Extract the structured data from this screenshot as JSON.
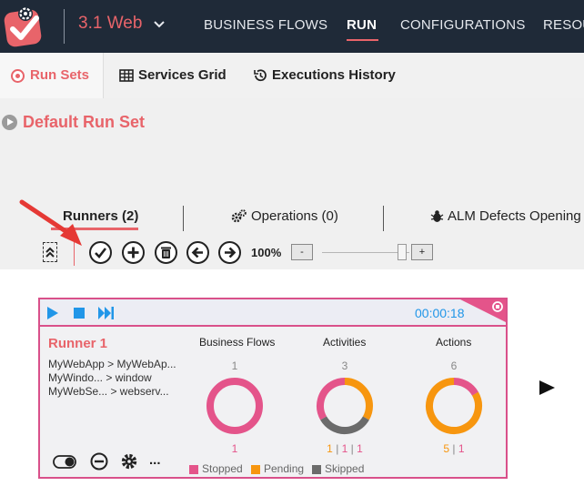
{
  "header": {
    "solution_name": "3.1 Web",
    "nav": [
      "BUSINESS FLOWS",
      "RUN",
      "CONFIGURATIONS",
      "RESOU"
    ]
  },
  "tabs": {
    "run_sets": "Run Sets",
    "services_grid": "Services Grid",
    "executions_history": "Executions History"
  },
  "runset": {
    "title": "Default Run Set",
    "subtabs": {
      "runners": "Runners (2)",
      "operations": "Operations (0)",
      "alm": "ALM Defects Opening"
    },
    "zoom": "100%",
    "zoom_minus": "-",
    "zoom_plus": "+",
    "zoom_level": 0.92
  },
  "runner": {
    "name": "Runner 1",
    "timer": "00:00:18",
    "flows": [
      "MyWebApp > MyWebAp...",
      "MyWindo... > window",
      "MyWebSe... > webserv..."
    ],
    "stats": {
      "business_flows": {
        "title": "Business Flows",
        "total": "1",
        "bottom": "1",
        "segments": [
          {
            "status": "Stopped",
            "value": 1
          }
        ]
      },
      "activities": {
        "title": "Activities",
        "total": "3",
        "bottom_parts": [
          "1",
          "1",
          "1"
        ],
        "segments": [
          {
            "status": "Stopped",
            "value": 1
          },
          {
            "status": "Pending",
            "value": 1
          },
          {
            "status": "Skipped",
            "value": 1
          }
        ]
      },
      "actions": {
        "title": "Actions",
        "total": "6",
        "bottom_parts": [
          "5",
          "1"
        ],
        "segments": [
          {
            "status": "Pending",
            "value": 5
          },
          {
            "status": "Stopped",
            "value": 1
          }
        ]
      }
    },
    "legend": [
      "Stopped",
      "Pending",
      "Skipped"
    ],
    "more": "..."
  },
  "colors": {
    "brand": "#e8646a",
    "stopped": "#e4548a",
    "pending": "#f7960f",
    "skipped": "#6b6b6b",
    "accent_blue": "#2196e8"
  }
}
